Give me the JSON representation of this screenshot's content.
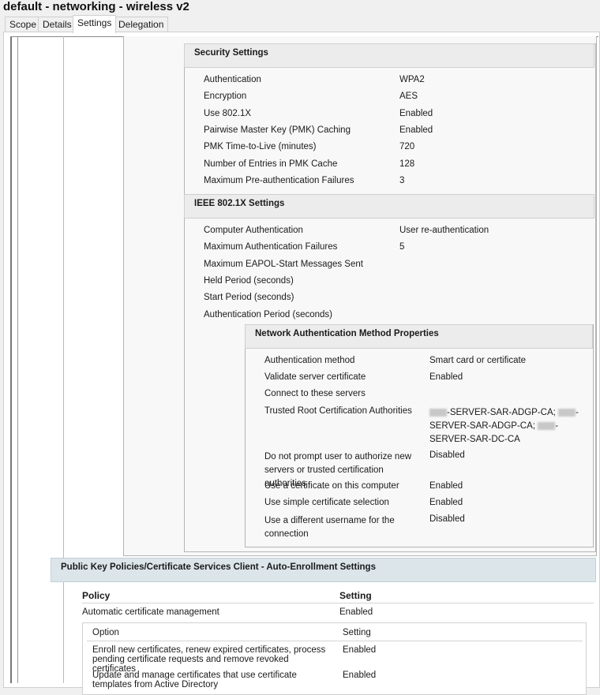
{
  "title": "default - networking - wireless v2",
  "tabs": [
    {
      "label": "Scope"
    },
    {
      "label": "Details"
    },
    {
      "label": "Settings"
    },
    {
      "label": "Delegation"
    }
  ],
  "security": {
    "header": "Security Settings",
    "rows": [
      {
        "label": "Authentication",
        "value": "WPA2"
      },
      {
        "label": "Encryption",
        "value": "AES"
      },
      {
        "label": "Use 802.1X",
        "value": "Enabled"
      },
      {
        "label": "Pairwise Master Key (PMK) Caching",
        "value": "Enabled"
      },
      {
        "label": "PMK Time-to-Live (minutes)",
        "value": "720"
      },
      {
        "label": "Number of Entries in PMK Cache",
        "value": "128"
      },
      {
        "label": "Maximum Pre-authentication Failures",
        "value": "3"
      }
    ]
  },
  "ieee": {
    "header": "IEEE 802.1X Settings",
    "rows": [
      {
        "label": "Computer Authentication",
        "value": "User re-authentication"
      },
      {
        "label": "Maximum Authentication Failures",
        "value": "5"
      },
      {
        "label": "Maximum EAPOL-Start Messages Sent",
        "value": ""
      },
      {
        "label": "Held Period (seconds)",
        "value": ""
      },
      {
        "label": "Start Period (seconds)",
        "value": ""
      },
      {
        "label": "Authentication Period (seconds)",
        "value": ""
      }
    ]
  },
  "namp": {
    "header": "Network Authentication Method Properties",
    "rows": [
      {
        "label": "Authentication method",
        "value": "Smart card or certificate"
      },
      {
        "label": "Validate server certificate",
        "value": "Enabled"
      },
      {
        "label": "Connect to these servers",
        "value": ""
      }
    ],
    "trusted_label": "Trusted Root Certification Authorities",
    "trusted_parts": [
      "-SERVER-SAR-ADGP-CA; ",
      "-",
      "SERVER-SAR-ADGP-CA; ",
      "-",
      "SERVER-SAR-DC-CA"
    ],
    "rows2": [
      {
        "label": "Do not prompt user to authorize new servers or trusted certification authorities",
        "value": "Disabled"
      },
      {
        "label": "Use a certificate on this computer",
        "value": "Enabled"
      },
      {
        "label": "Use simple certificate selection",
        "value": "Enabled"
      },
      {
        "label": "Use a different username for the connection",
        "value": "Disabled"
      }
    ]
  },
  "pki": {
    "header": "Public Key Policies/Certificate Services Client - Auto-Enrollment Settings",
    "col_policy": "Policy",
    "col_setting": "Setting",
    "policy_row": {
      "label": "Automatic certificate management",
      "value": "Enabled"
    },
    "option_col": "Option",
    "option_setting_col": "Setting",
    "options": [
      {
        "label": "Enroll new certificates, renew expired certificates, process pending certificate requests and remove revoked certificates",
        "value": "Enabled"
      },
      {
        "label": "Update and manage certificates that use certificate templates from Active Directory",
        "value": "Enabled"
      }
    ]
  }
}
